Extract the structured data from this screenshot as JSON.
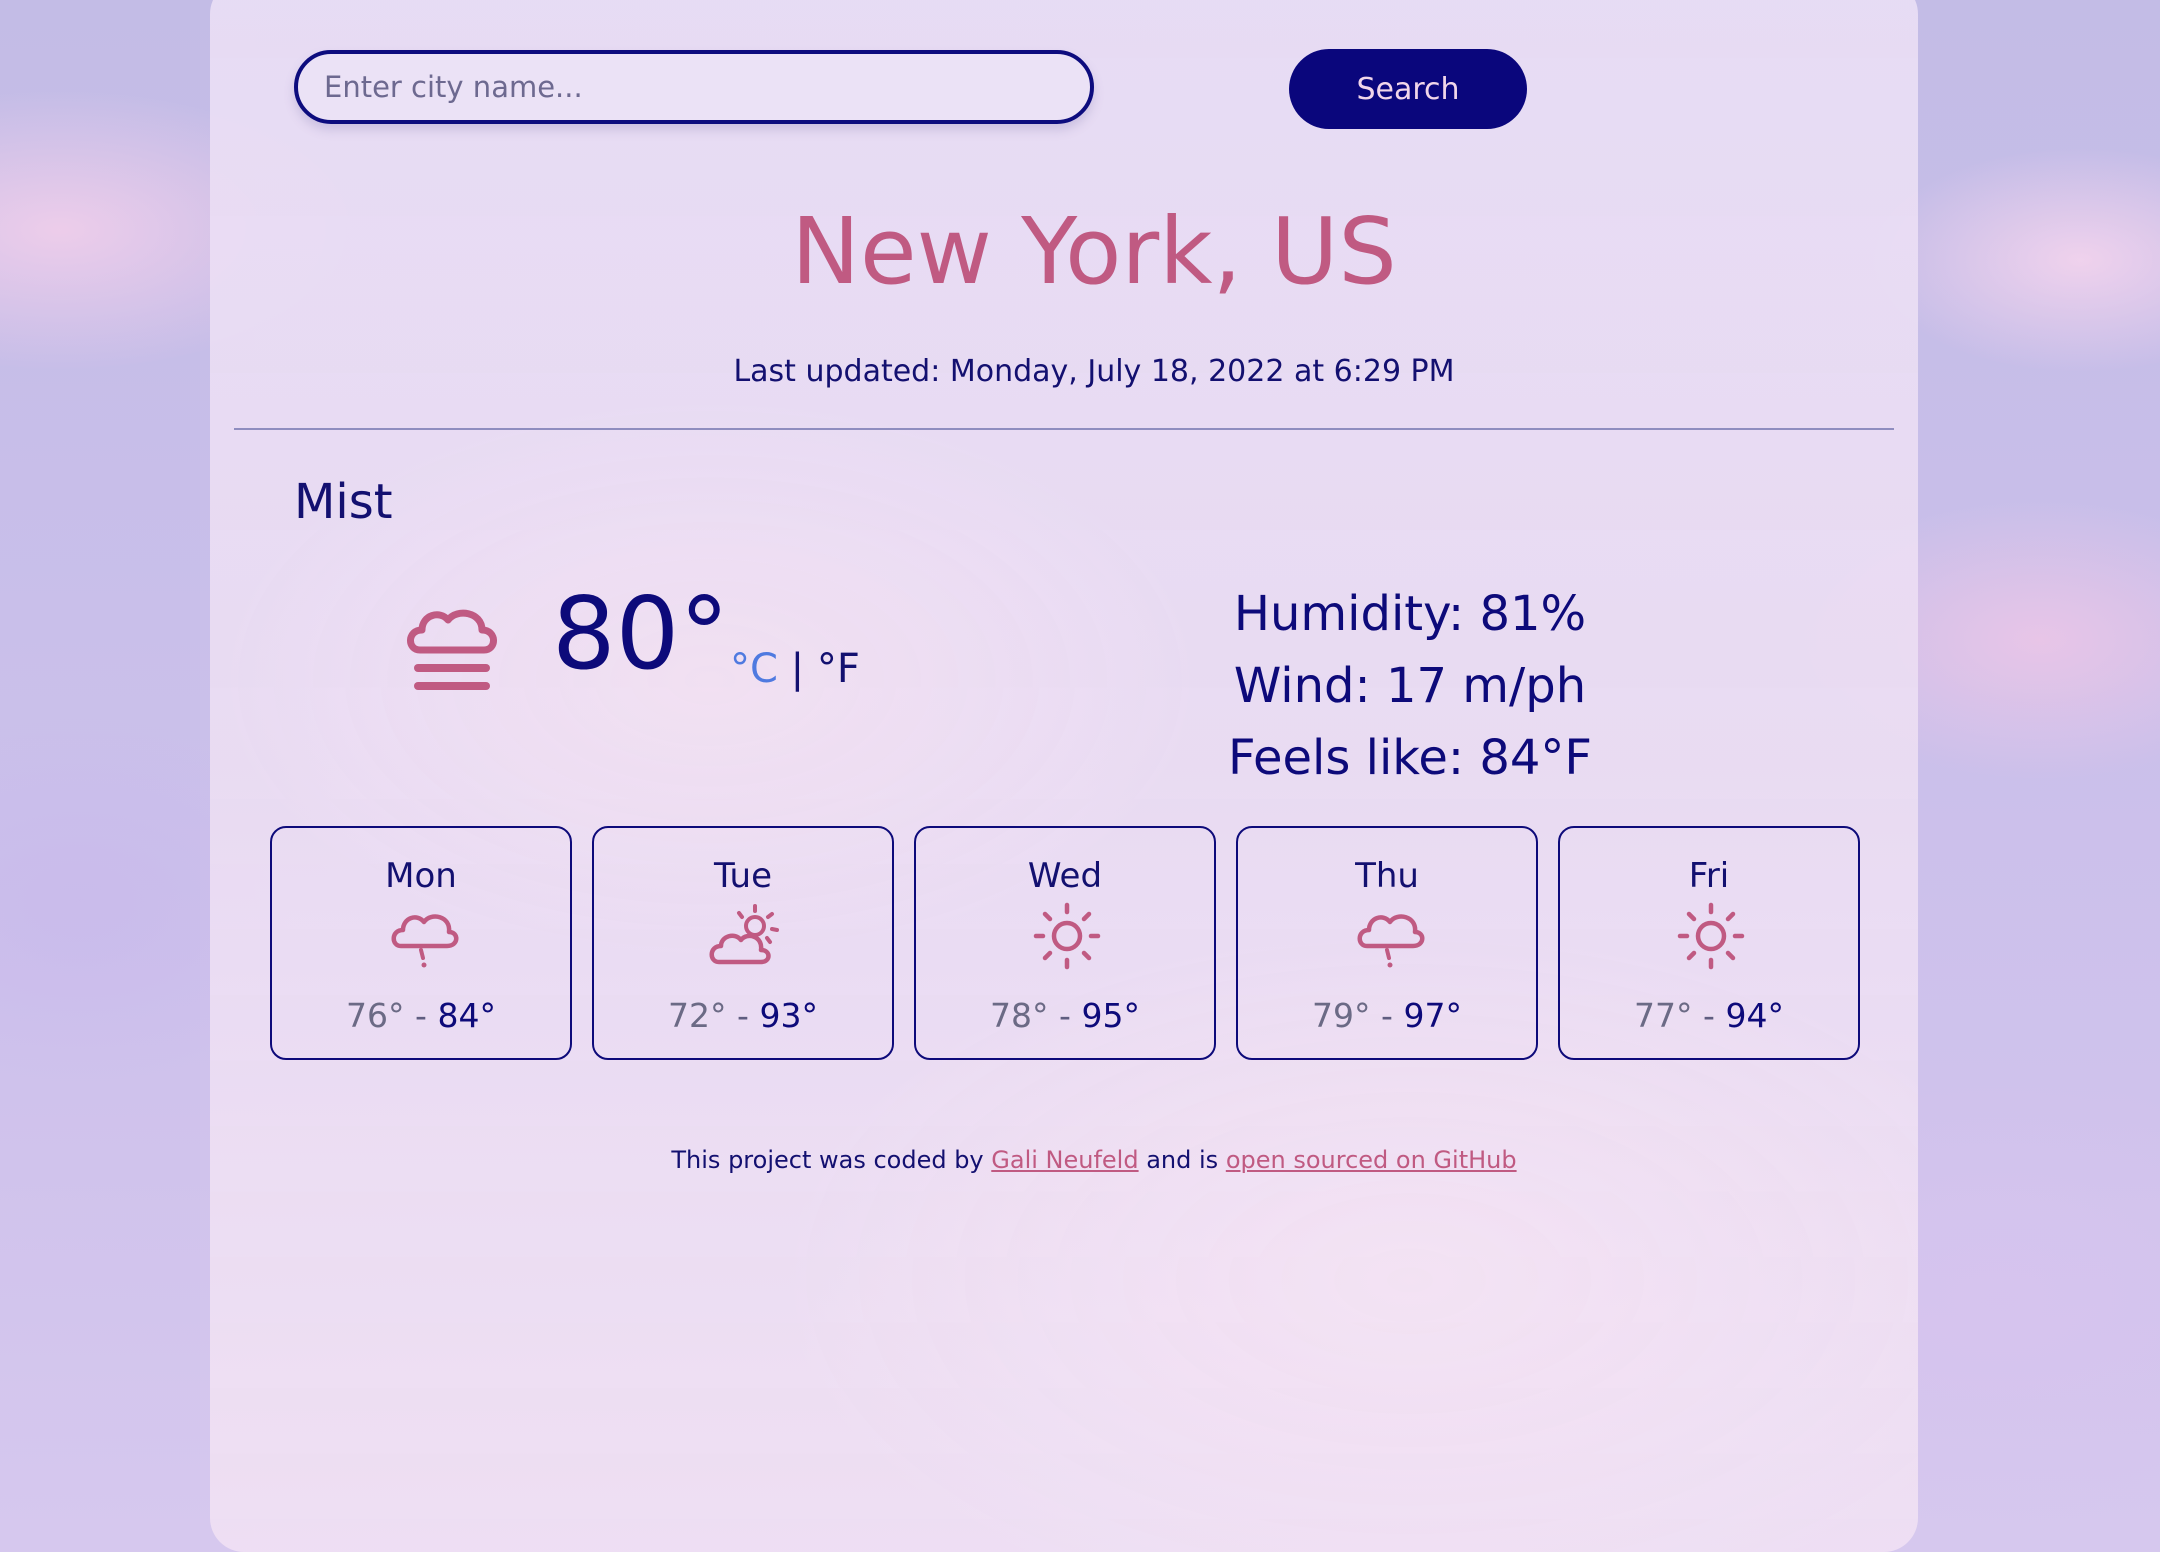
{
  "search": {
    "placeholder": "Enter city name...",
    "button_label": "Search"
  },
  "location": {
    "city": "New York, US",
    "last_updated": "Last updated: Monday, July 18, 2022 at 6:29 PM"
  },
  "current": {
    "condition": "Mist",
    "icon": "mist-icon",
    "temperature": "80°",
    "unit_c": "°C",
    "unit_separator": "|",
    "unit_f": "°F",
    "humidity": "Humidity: 81%",
    "wind": "Wind: 17 m/ph",
    "feels_like": "Feels like: 84°F"
  },
  "forecast": [
    {
      "day": "Mon",
      "icon": "rain-cloud-icon",
      "min": "76°",
      "max": "84°"
    },
    {
      "day": "Tue",
      "icon": "partly-cloudy-icon",
      "min": "72°",
      "max": "93°"
    },
    {
      "day": "Wed",
      "icon": "sun-icon",
      "min": "78°",
      "max": "95°"
    },
    {
      "day": "Thu",
      "icon": "rain-cloud-icon",
      "min": "79°",
      "max": "97°"
    },
    {
      "day": "Fri",
      "icon": "sun-icon",
      "min": "77°",
      "max": "94°"
    }
  ],
  "forecast_separator": "-",
  "footer": {
    "prefix": "This project was coded by ",
    "author_link": "Gali Neufeld",
    "middle": " and is ",
    "repo_link": "open sourced on GitHub"
  },
  "colors": {
    "accent": "#c05a82",
    "primary": "#0d0a7a",
    "unit_active": "#4f7ae0"
  }
}
